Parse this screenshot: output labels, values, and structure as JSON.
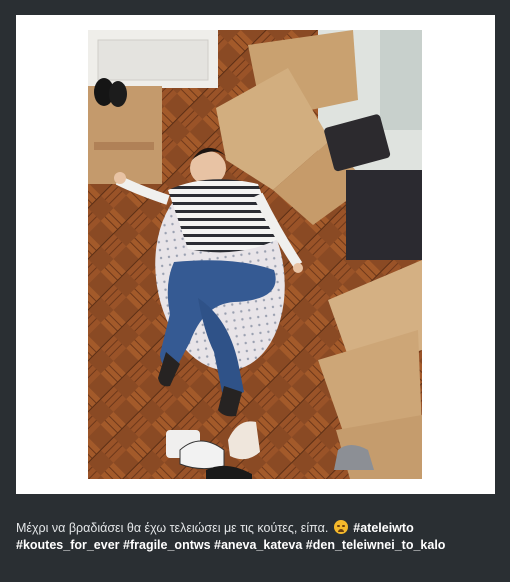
{
  "post": {
    "photo_alt": "Photo of a woman lying on a patterned bean bag on a parquet floor surrounded by moving boxes",
    "caption_text": "Μέχρι να βραδιάσει θα έχω τελειώσει με τις κούτες, είπα.",
    "emoji_name": "weary-face-emoji",
    "hashtags": [
      "#ateleiwto",
      "#koutes_for_ever",
      "#fragile_ontws",
      "#aneva_kateva",
      "#den_teleiwnei_to_kalo"
    ]
  }
}
